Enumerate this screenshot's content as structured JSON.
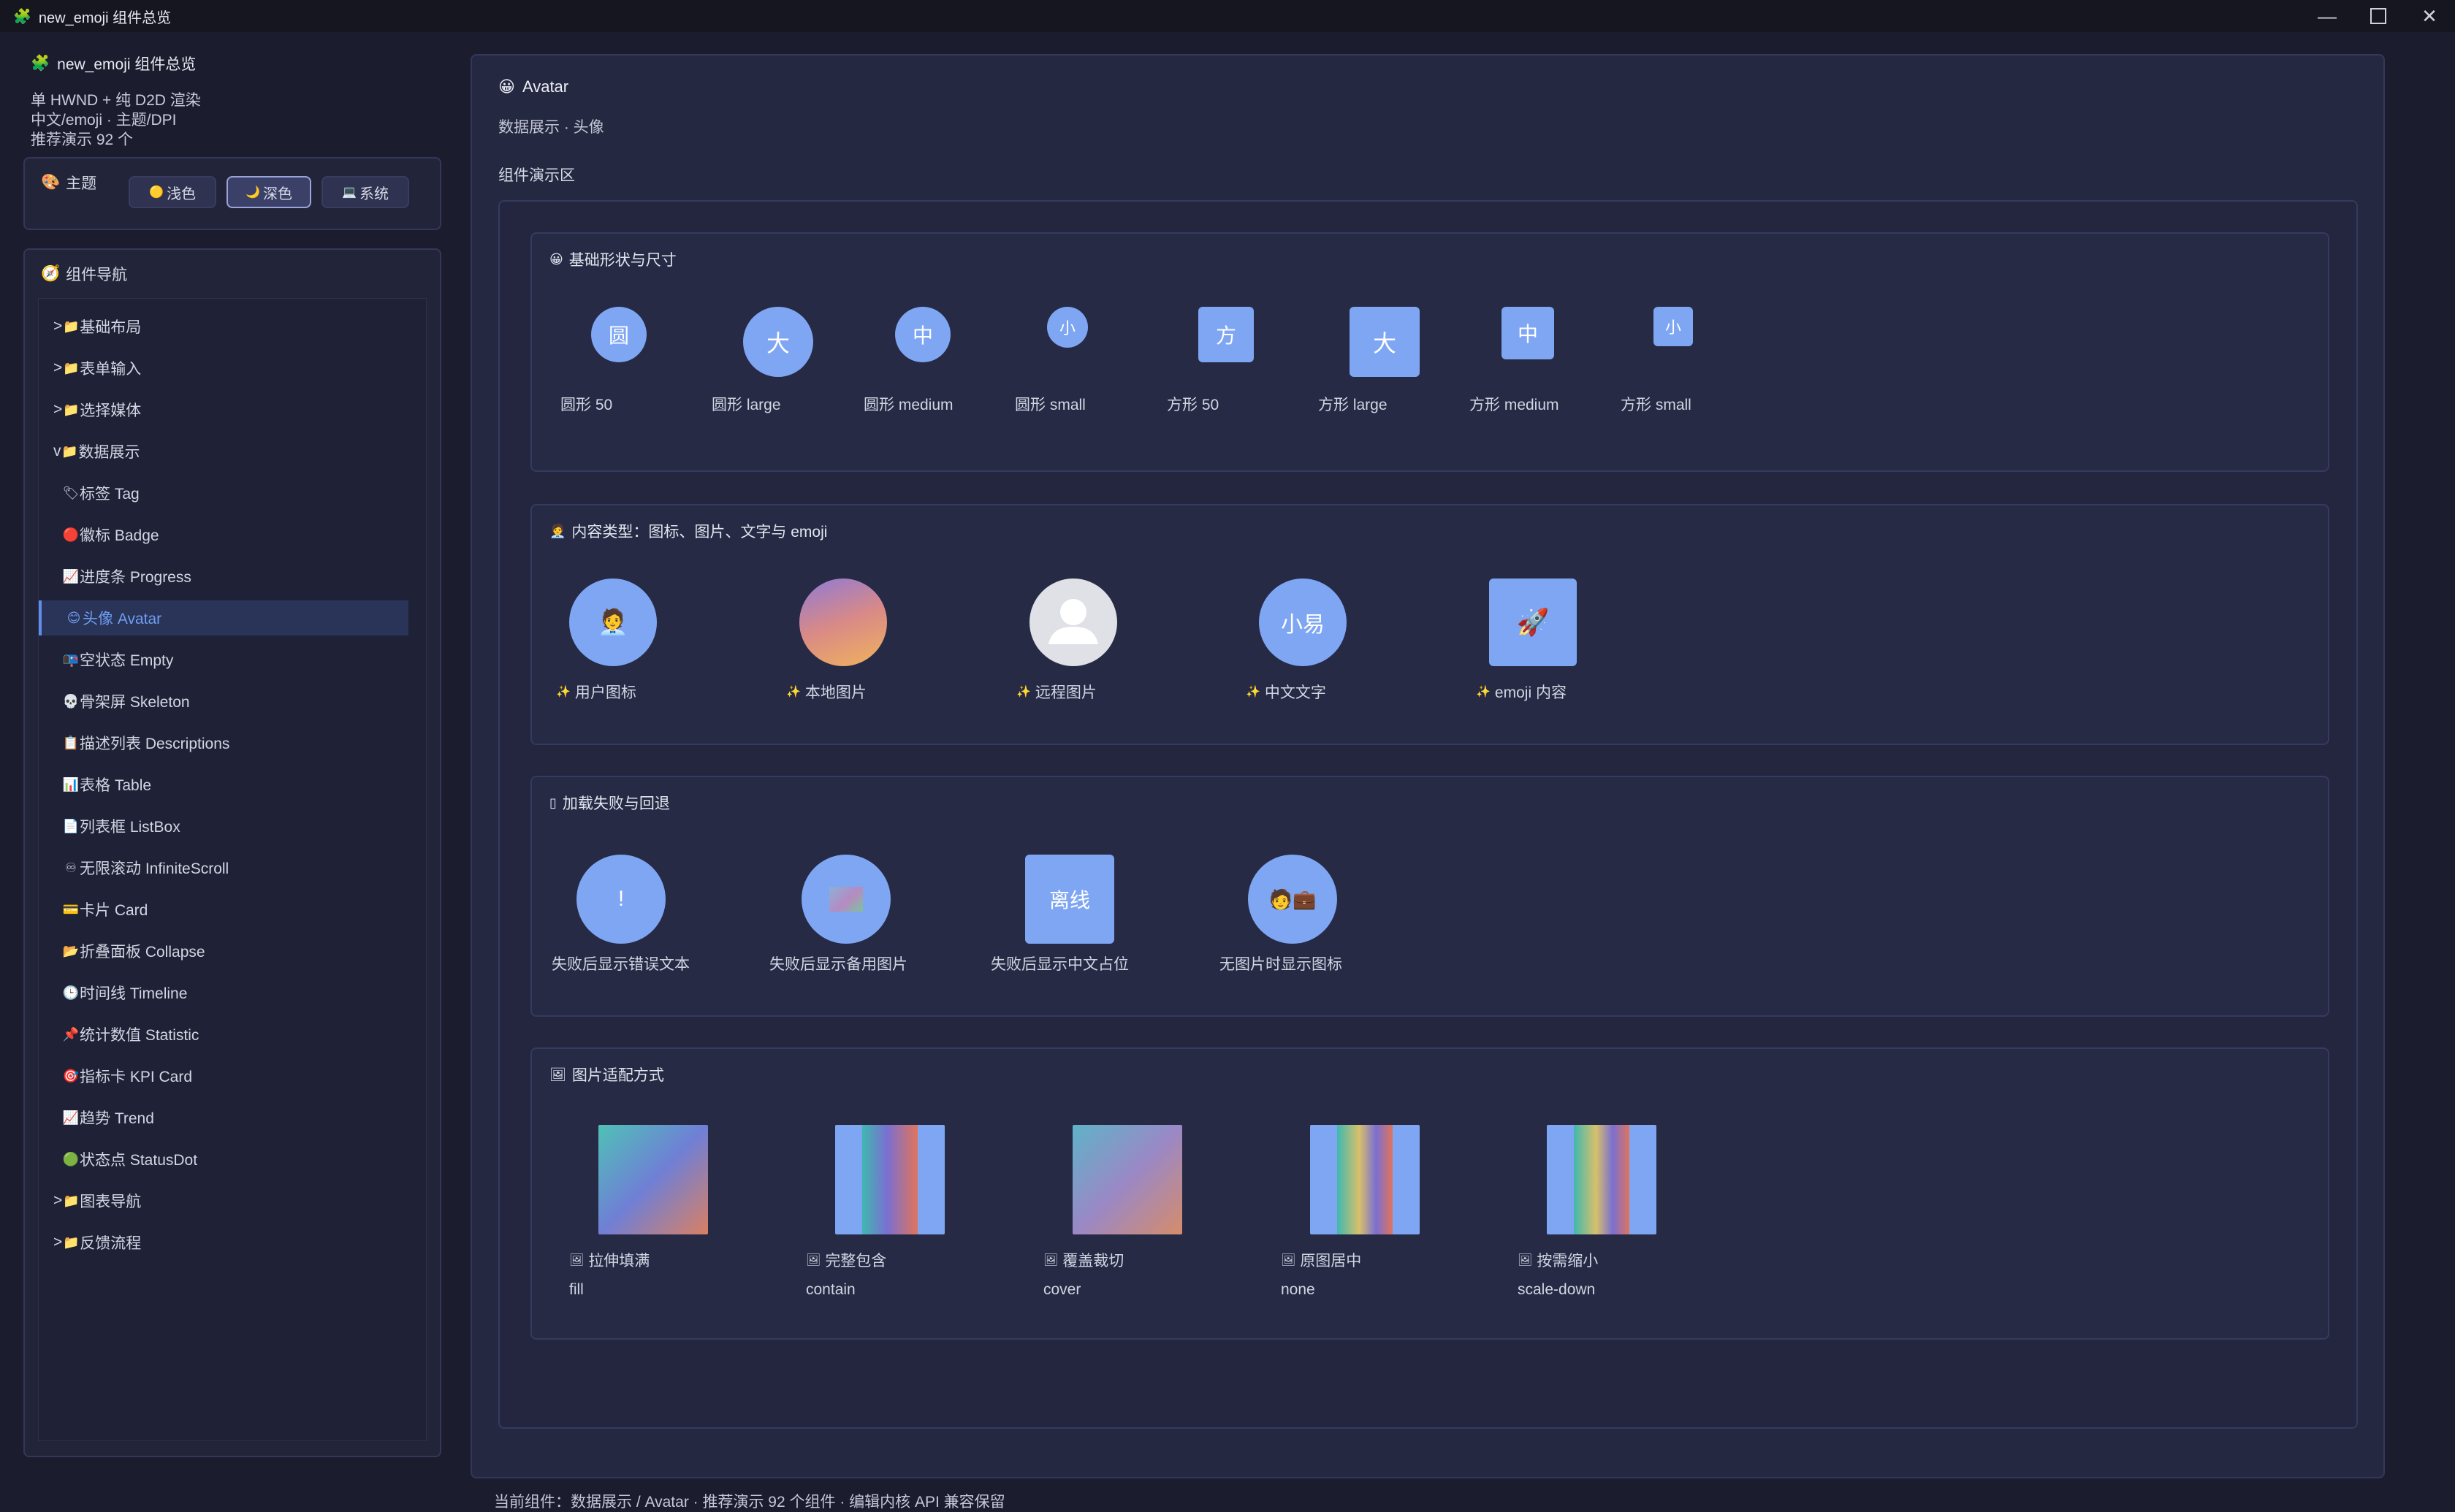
{
  "window": {
    "title": "new_emoji 组件总览",
    "app_icon": "🧩"
  },
  "sidebar": {
    "head_title": "new_emoji 组件总览",
    "sub_lines": [
      "单 HWND + 纯 D2D 渲染",
      "中文/emoji · 主题/DPI",
      "推荐演示 92 个"
    ],
    "theme": {
      "label": "主题",
      "icon": "🎨",
      "buttons": [
        {
          "icon": "🟡",
          "label": "浅色",
          "active": false
        },
        {
          "icon": "🌙",
          "label": "深色",
          "active": true
        },
        {
          "icon": "💻",
          "label": "系统",
          "active": false
        }
      ]
    },
    "nav": {
      "label": "组件导航",
      "icon": "🧭",
      "items": [
        {
          "prefix": ">",
          "icon": "📁",
          "label": "基础布局",
          "level": 0
        },
        {
          "prefix": ">",
          "icon": "📁",
          "label": "表单输入",
          "level": 0
        },
        {
          "prefix": ">",
          "icon": "📁",
          "label": "选择媒体",
          "level": 0
        },
        {
          "prefix": "v",
          "icon": "📁",
          "label": "数据展示",
          "level": 0
        },
        {
          "prefix": "",
          "icon": "🏷",
          "label": "标签 Tag",
          "level": 1
        },
        {
          "prefix": "",
          "icon": "🔴",
          "label": "徽标 Badge",
          "level": 1
        },
        {
          "prefix": "",
          "icon": "📈",
          "label": "进度条 Progress",
          "level": 1
        },
        {
          "prefix": "",
          "icon": "😊",
          "label": "头像 Avatar",
          "level": 1,
          "active": true
        },
        {
          "prefix": "",
          "icon": "📭",
          "label": "空状态 Empty",
          "level": 1
        },
        {
          "prefix": "",
          "icon": "💀",
          "label": "骨架屏 Skeleton",
          "level": 1
        },
        {
          "prefix": "",
          "icon": "📋",
          "label": "描述列表 Descriptions",
          "level": 1
        },
        {
          "prefix": "",
          "icon": "📊",
          "label": "表格 Table",
          "level": 1
        },
        {
          "prefix": "",
          "icon": "📄",
          "label": "列表框 ListBox",
          "level": 1
        },
        {
          "prefix": "",
          "icon": "♾",
          "label": "无限滚动 InfiniteScroll",
          "level": 1
        },
        {
          "prefix": "",
          "icon": "💳",
          "label": "卡片 Card",
          "level": 1
        },
        {
          "prefix": "",
          "icon": "📂",
          "label": "折叠面板 Collapse",
          "level": 1
        },
        {
          "prefix": "",
          "icon": "🕒",
          "label": "时间线 Timeline",
          "level": 1
        },
        {
          "prefix": "",
          "icon": "📌",
          "label": "统计数值 Statistic",
          "level": 1
        },
        {
          "prefix": "",
          "icon": "🎯",
          "label": "指标卡 KPI Card",
          "level": 1
        },
        {
          "prefix": "",
          "icon": "📈",
          "label": "趋势 Trend",
          "level": 1
        },
        {
          "prefix": "",
          "icon": "🟢",
          "label": "状态点 StatusDot",
          "level": 1
        },
        {
          "prefix": ">",
          "icon": "📁",
          "label": "图表导航",
          "level": 0
        },
        {
          "prefix": ">",
          "icon": "📁",
          "label": "反馈流程",
          "level": 0
        }
      ]
    }
  },
  "main": {
    "title_icon": "😀",
    "title": "Avatar",
    "subtitle": "数据展示 · 头像",
    "demo_label": "组件演示区",
    "sections": {
      "shapes": {
        "icon": "😀",
        "title": "基础形状与尺寸",
        "items": [
          {
            "text": "圆",
            "caption": "圆形 50"
          },
          {
            "text": "大",
            "caption": "圆形 large"
          },
          {
            "text": "中",
            "caption": "圆形 medium"
          },
          {
            "text": "小",
            "caption": "圆形 small"
          },
          {
            "text": "方",
            "caption": "方形 50"
          },
          {
            "text": "大",
            "caption": "方形 large"
          },
          {
            "text": "中",
            "caption": "方形 medium"
          },
          {
            "text": "小",
            "caption": "方形 small"
          }
        ]
      },
      "content": {
        "icon": "🧑‍💼",
        "title": "内容类型：图标、图片、文字与 emoji",
        "caption_icon": "✨",
        "items": [
          {
            "text": "🧑‍💼",
            "caption": "用户图标"
          },
          {
            "text": "",
            "caption": "本地图片"
          },
          {
            "text": "",
            "caption": "远程图片"
          },
          {
            "text": "小易",
            "caption": "中文文字"
          },
          {
            "text": "🚀",
            "caption": "emoji 内容"
          }
        ]
      },
      "fallback": {
        "icon": "▯",
        "title": "加载失败与回退",
        "items": [
          {
            "text": "!",
            "caption": "失败后显示错误文本"
          },
          {
            "text": "",
            "caption": "失败后显示备用图片"
          },
          {
            "text": "离线",
            "caption": "失败后显示中文占位"
          },
          {
            "text": "🧑💼",
            "caption": "无图片时显示图标"
          }
        ]
      },
      "fit": {
        "icon": "🖼",
        "title": "图片适配方式",
        "items": [
          {
            "icon": "🖼",
            "caption": "拉伸填满",
            "mode": "fill"
          },
          {
            "icon": "🖼",
            "caption": "完整包含",
            "mode": "contain"
          },
          {
            "icon": "🖼",
            "caption": "覆盖裁切",
            "mode": "cover"
          },
          {
            "icon": "🖼",
            "caption": "原图居中",
            "mode": "none"
          },
          {
            "icon": "🖼",
            "caption": "按需缩小",
            "mode": "scale-down"
          }
        ]
      }
    }
  },
  "footer": {
    "text": "当前组件：数据展示 / Avatar · 推荐演示 92 个组件 · 编辑内核 API 兼容保留"
  },
  "colors": {
    "accent": "#7ea6f3",
    "active_nav": "#6d9ef0",
    "background": "#1b1c2e"
  }
}
